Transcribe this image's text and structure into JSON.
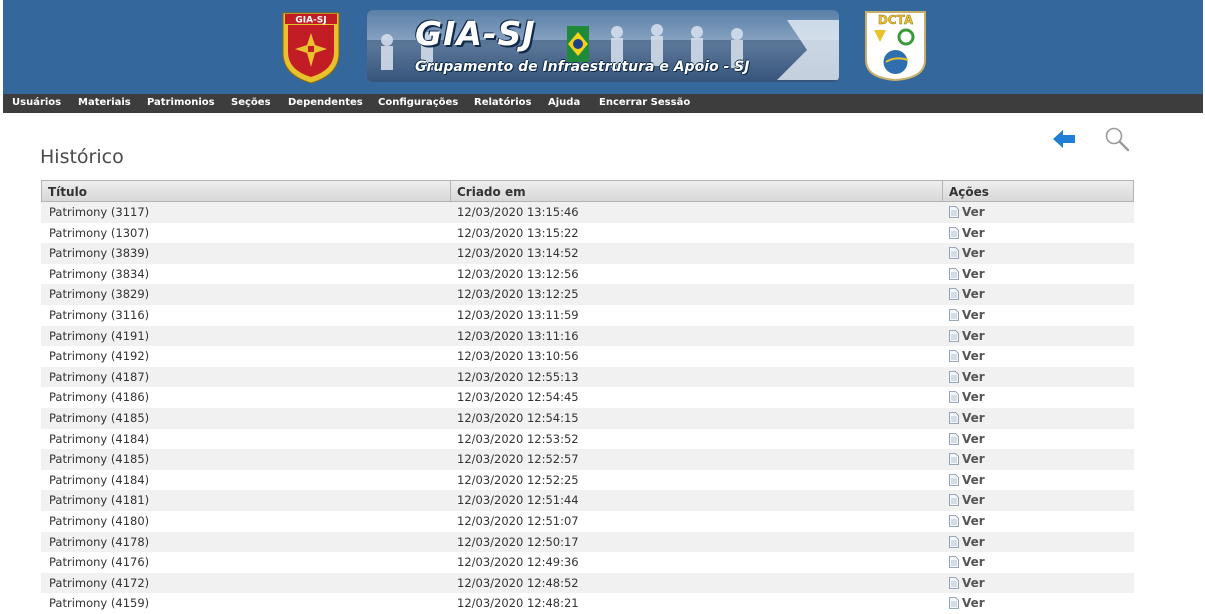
{
  "header": {
    "left_badge_text": "GIA-SJ",
    "banner_title": "GIA-SJ",
    "banner_subtitle": "Grupamento de Infraestrutura e Apoio - SJ",
    "right_badge_text": "DCTA"
  },
  "menu": [
    {
      "label": "Usuários"
    },
    {
      "label": "Materiais"
    },
    {
      "label": "Patrimonios"
    },
    {
      "label": "Seções"
    },
    {
      "label": "Dependentes"
    },
    {
      "label": "Configurações"
    },
    {
      "label": "Relatórios"
    },
    {
      "label": "Ajuda"
    },
    {
      "label": "Encerrar Sessão"
    }
  ],
  "page": {
    "title": "Histórico",
    "back_icon": "arrow-left-icon",
    "search_icon": "magnifier-icon"
  },
  "table": {
    "columns": [
      "Título",
      "Criado em",
      "Ações"
    ],
    "action_label": "Ver",
    "rows": [
      {
        "titulo": "Patrimony (3117)",
        "criado": "12/03/2020 13:15:46"
      },
      {
        "titulo": "Patrimony (1307)",
        "criado": "12/03/2020 13:15:22"
      },
      {
        "titulo": "Patrimony (3839)",
        "criado": "12/03/2020 13:14:52"
      },
      {
        "titulo": "Patrimony (3834)",
        "criado": "12/03/2020 13:12:56"
      },
      {
        "titulo": "Patrimony (3829)",
        "criado": "12/03/2020 13:12:25"
      },
      {
        "titulo": "Patrimony (3116)",
        "criado": "12/03/2020 13:11:59"
      },
      {
        "titulo": "Patrimony (4191)",
        "criado": "12/03/2020 13:11:16"
      },
      {
        "titulo": "Patrimony (4192)",
        "criado": "12/03/2020 13:10:56"
      },
      {
        "titulo": "Patrimony (4187)",
        "criado": "12/03/2020 12:55:13"
      },
      {
        "titulo": "Patrimony (4186)",
        "criado": "12/03/2020 12:54:45"
      },
      {
        "titulo": "Patrimony (4185)",
        "criado": "12/03/2020 12:54:15"
      },
      {
        "titulo": "Patrimony (4184)",
        "criado": "12/03/2020 12:53:52"
      },
      {
        "titulo": "Patrimony (4185)",
        "criado": "12/03/2020 12:52:57"
      },
      {
        "titulo": "Patrimony (4184)",
        "criado": "12/03/2020 12:52:25"
      },
      {
        "titulo": "Patrimony (4181)",
        "criado": "12/03/2020 12:51:44"
      },
      {
        "titulo": "Patrimony (4180)",
        "criado": "12/03/2020 12:51:07"
      },
      {
        "titulo": "Patrimony (4178)",
        "criado": "12/03/2020 12:50:17"
      },
      {
        "titulo": "Patrimony (4176)",
        "criado": "12/03/2020 12:49:36"
      },
      {
        "titulo": "Patrimony (4172)",
        "criado": "12/03/2020 12:48:52"
      },
      {
        "titulo": "Patrimony (4159)",
        "criado": "12/03/2020 12:48:21"
      }
    ]
  },
  "colors": {
    "header_bg": "#34679b",
    "menubar_bg": "#3d3d3d",
    "accent_arrow": "#1f7ed6"
  }
}
